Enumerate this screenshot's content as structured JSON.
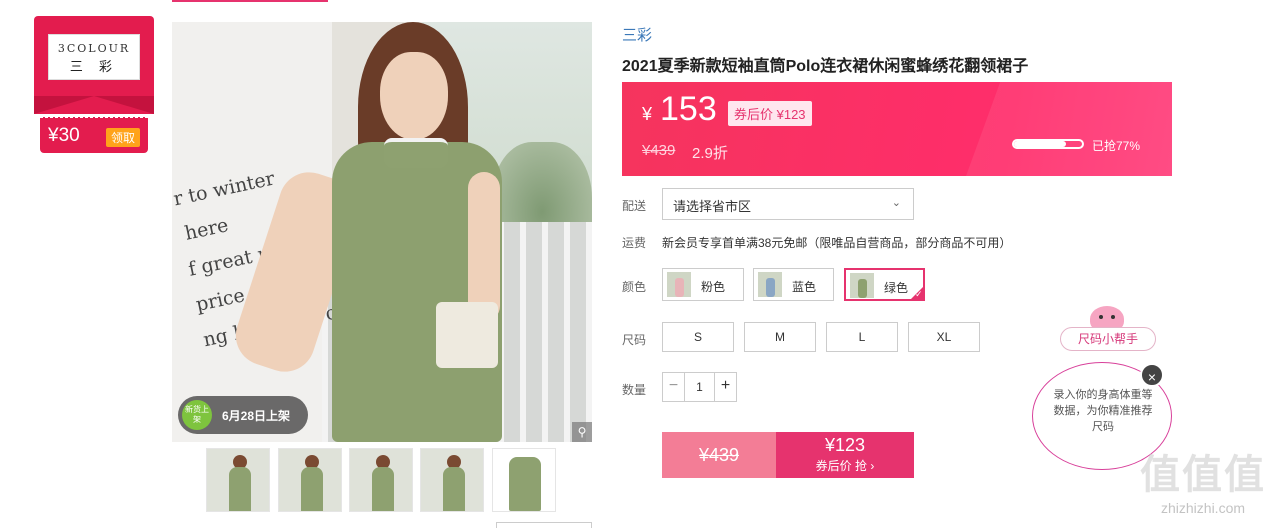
{
  "brand_card": {
    "logo_en": "3COLOUR",
    "logo_cn": "三 彩",
    "coupon_amount": "¥30",
    "claim_label": "领取"
  },
  "product": {
    "image_overlay_text": [
      "r to winter",
      "here",
      "f great material",
      "price",
      "ng here for you"
    ],
    "new_badge_label": "新货上架",
    "launch_date": "6月28日上架",
    "thumbnail_count": 5,
    "brand_name": "三彩",
    "title": "2021夏季新款短袖直筒Polo连衣裙休闲蜜蜂绣花翻领裙子"
  },
  "price": {
    "currency": "¥",
    "current": "153",
    "after_coupon_label": "券后价 ¥123",
    "original": "¥439",
    "discount": "2.9折",
    "sold_percent": 77,
    "sold_label": "已抢77%"
  },
  "delivery": {
    "label": "配送",
    "select_value": "请选择省市区"
  },
  "shipping": {
    "label": "运费",
    "text": "新会员专享首单满38元免邮（限唯品自营商品，部分商品不可用）"
  },
  "colors": {
    "label": "颜色",
    "options": [
      {
        "name": "粉色",
        "swatch": "#e8b4b8"
      },
      {
        "name": "蓝色",
        "swatch": "#8aa6c4"
      },
      {
        "name": "绿色",
        "swatch": "#8ea170"
      }
    ],
    "selected": "绿色"
  },
  "sizes": {
    "label": "尺码",
    "options": [
      "S",
      "M",
      "L",
      "XL"
    ]
  },
  "quantity": {
    "label": "数量",
    "value": "1",
    "minus": "−",
    "plus": "+"
  },
  "buy": {
    "original_price": "¥439",
    "coupon_price": "¥123",
    "coupon_action": "券后价 抢 ›"
  },
  "size_helper": {
    "tag": "尺码小帮手",
    "bubble_text": "录入你的身高体重等数据，为你精准推荐尺码",
    "close": "×"
  },
  "watermark": {
    "glyphs": "值值值",
    "domain": "zhizhizhi.com"
  },
  "colors_theme": {
    "accent": "#e6336e",
    "price_panel": "#ff2d6b",
    "brand_red": "#e31c4e",
    "link_blue": "#3b78b8"
  }
}
